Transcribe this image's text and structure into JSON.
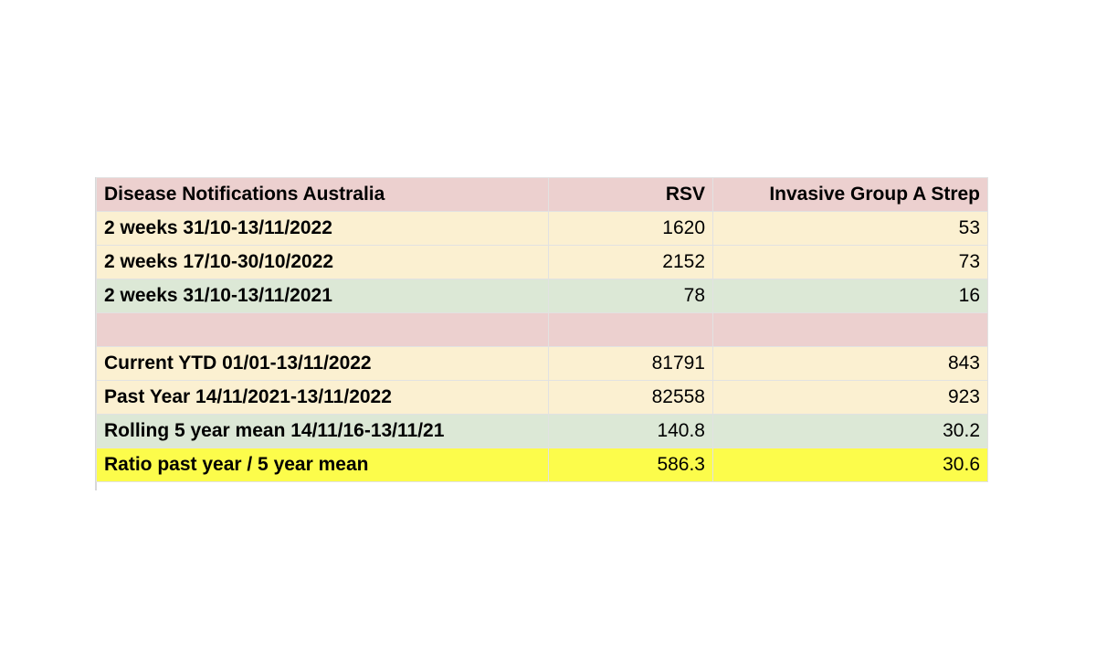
{
  "table": {
    "headers": [
      "Disease Notifications Australia",
      "RSV",
      "Invasive Group A Strep"
    ],
    "header_color": "#ecd0cf",
    "rows": [
      {
        "label": "2 weeks 31/10-13/11/2022",
        "rsv": "1620",
        "igas": "53",
        "color": "#fbf0d1"
      },
      {
        "label": "2 weeks 17/10-30/10/2022",
        "rsv": "2152",
        "igas": "73",
        "color": "#fbf0d1"
      },
      {
        "label": "2 weeks 31/10-13/11/2021",
        "rsv": "78",
        "igas": "16",
        "color": "#dce8d6"
      },
      {
        "label": "",
        "rsv": "",
        "igas": "",
        "color": "#ecd0cf"
      },
      {
        "label": "Current YTD 01/01-13/11/2022",
        "rsv": "81791",
        "igas": "843",
        "color": "#fbf0d1"
      },
      {
        "label": "Past Year 14/11/2021-13/11/2022",
        "rsv": "82558",
        "igas": "923",
        "color": "#fbf0d1"
      },
      {
        "label": "Rolling 5 year mean 14/11/16-13/11/21",
        "rsv": "140.8",
        "igas": "30.2",
        "color": "#dce8d6"
      },
      {
        "label": "Ratio past year / 5 year mean",
        "rsv": "586.3",
        "igas": "30.6",
        "color": "#fcfc4b"
      }
    ]
  }
}
